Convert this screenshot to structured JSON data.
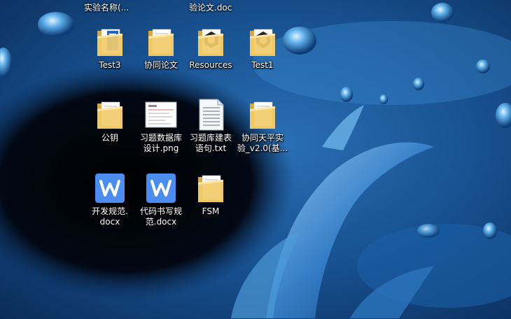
{
  "desktop": {
    "partial_top_labels": [
      "实验名称(...",
      "验论文.doc"
    ],
    "icons": [
      {
        "id": "test3",
        "label": "Test3",
        "icon": "folder-doc-icon",
        "col": 0,
        "row": 0
      },
      {
        "id": "xietong-lunwen",
        "label": "协同论文",
        "icon": "folder-icon",
        "col": 1,
        "row": 0
      },
      {
        "id": "resources",
        "label": "Resources",
        "icon": "folder-unity-icon",
        "col": 2,
        "row": 0
      },
      {
        "id": "test1",
        "label": "Test1",
        "icon": "folder-unity-icon",
        "col": 3,
        "row": 0
      },
      {
        "id": "gongyao",
        "label": "公钥",
        "icon": "folder-icon",
        "col": 0,
        "row": 1
      },
      {
        "id": "xiti-png",
        "label": "习题数据库\n设计.png",
        "icon": "image-file-icon",
        "col": 1,
        "row": 1
      },
      {
        "id": "xiti-txt",
        "label": "习题库建表\n语句.txt",
        "icon": "text-file-icon",
        "col": 2,
        "row": 1
      },
      {
        "id": "xietong-tianping",
        "label": "协同天平实\n验_v2.0(基...",
        "icon": "folder-icon",
        "col": 3,
        "row": 1
      },
      {
        "id": "kaifa-guifan",
        "label": "开发规范.\ndocx",
        "icon": "wps-doc-icon",
        "col": 0,
        "row": 2
      },
      {
        "id": "daima-guifan",
        "label": "代码书写规\n范.docx",
        "icon": "wps-doc-icon",
        "col": 1,
        "row": 2
      },
      {
        "id": "fsm",
        "label": "FSM",
        "icon": "folder-icon",
        "col": 2,
        "row": 2
      }
    ],
    "colors": {
      "wps": "#4a8cf0",
      "folder": "#f2cc6b",
      "folder_dark": "#d9a73c"
    }
  }
}
